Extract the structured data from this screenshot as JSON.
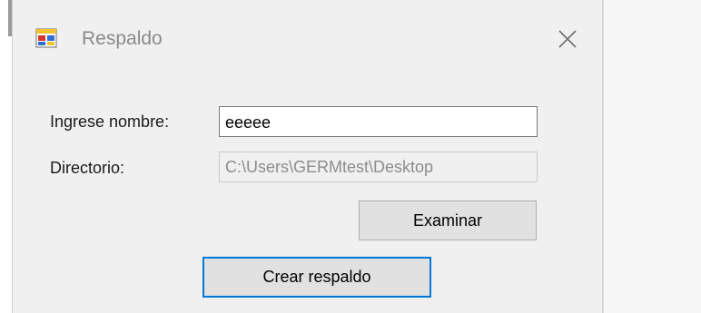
{
  "window": {
    "title": "Respaldo",
    "app_icon": "form-window-icon",
    "close_icon": "close-icon"
  },
  "form": {
    "name_label": "Ingrese nombre:",
    "name_value": "eeeee",
    "dir_label": "Directorio:",
    "dir_value": "C:\\Users\\GERMtest\\Desktop",
    "browse_label": "Examinar",
    "create_label": "Crear respaldo"
  },
  "colors": {
    "accent_focus": "#0078d7",
    "window_bg": "#f0f0f0",
    "button_bg": "#e1e1e1"
  }
}
